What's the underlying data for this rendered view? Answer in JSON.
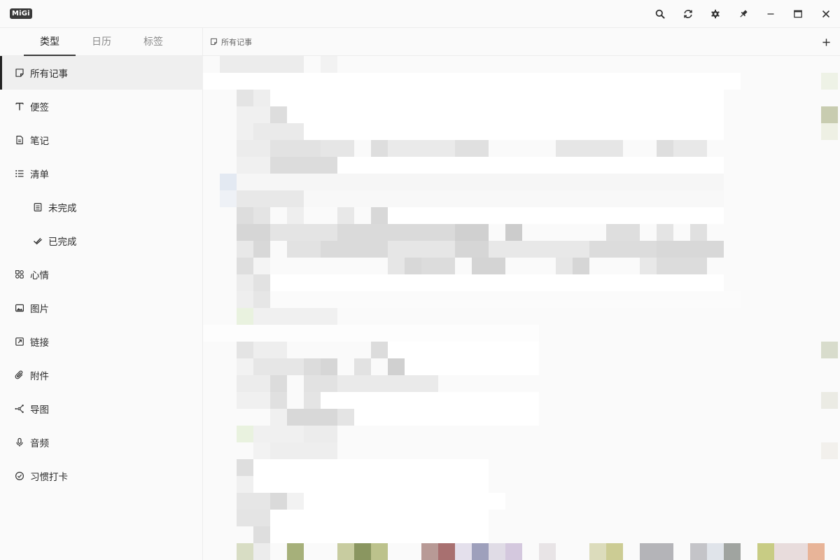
{
  "app": {
    "logo_text": "MiGi"
  },
  "titlebar": {
    "buttons": [
      {
        "name": "search-button",
        "icon": "search-icon"
      },
      {
        "name": "sync-button",
        "icon": "sync-icon"
      },
      {
        "name": "settings-button",
        "icon": "gear-icon"
      },
      {
        "name": "pin-button",
        "icon": "pin-icon"
      },
      {
        "name": "minimize-button",
        "icon": "minimize-icon"
      },
      {
        "name": "maximize-button",
        "icon": "maximize-icon"
      },
      {
        "name": "close-button",
        "icon": "close-icon"
      }
    ]
  },
  "sidebar": {
    "tabs": [
      {
        "label": "类型",
        "active": true
      },
      {
        "label": "日历",
        "active": false
      },
      {
        "label": "标签",
        "active": false
      }
    ],
    "items": [
      {
        "label": "所有记事",
        "icon": "note-icon",
        "active": true
      },
      {
        "label": "便签",
        "icon": "text-icon"
      },
      {
        "label": "笔记",
        "icon": "document-icon"
      },
      {
        "label": "清单",
        "icon": "list-icon"
      },
      {
        "label": "未完成",
        "icon": "checklist-icon",
        "sub": true
      },
      {
        "label": "已完成",
        "icon": "double-check-icon",
        "sub": true
      },
      {
        "label": "心情",
        "icon": "mood-grid-icon"
      },
      {
        "label": "图片",
        "icon": "image-icon"
      },
      {
        "label": "链接",
        "icon": "link-icon"
      },
      {
        "label": "附件",
        "icon": "paperclip-icon"
      },
      {
        "label": "导图",
        "icon": "mindmap-icon"
      },
      {
        "label": "音频",
        "icon": "microphone-icon"
      },
      {
        "label": "习惯打卡",
        "icon": "habit-check-icon"
      }
    ]
  },
  "main": {
    "header": {
      "title": "所有记事",
      "icon": "note-icon"
    },
    "add_button": {
      "icon": "plus-icon"
    }
  },
  "colors": {
    "accent": "#222222",
    "background": "#fafafa",
    "active_item": "#efefef",
    "border": "#ececec"
  }
}
